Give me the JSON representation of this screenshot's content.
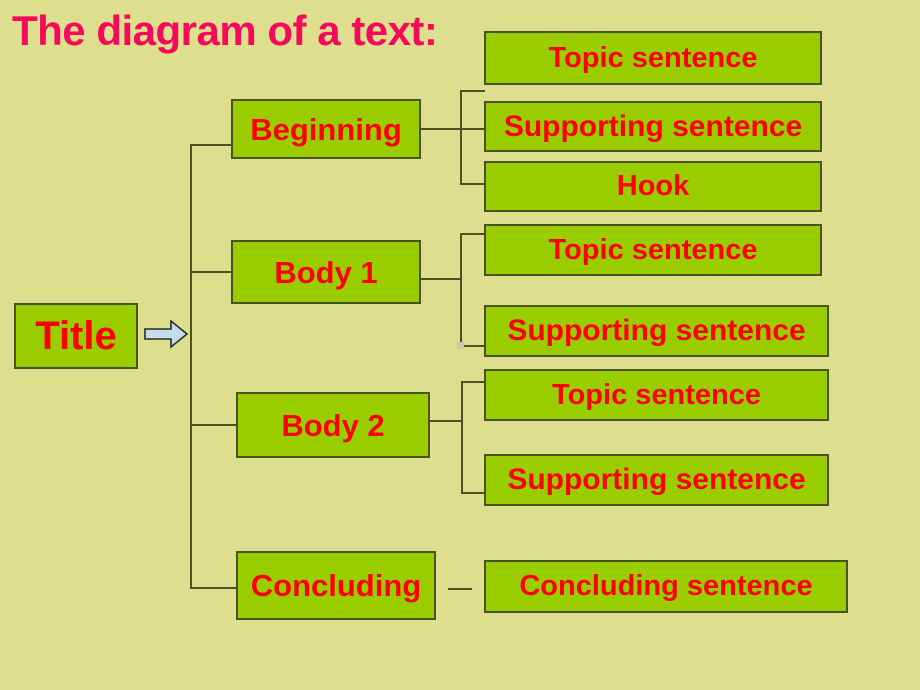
{
  "slide": {
    "title": "The diagram of a text:",
    "background_color": "#dede8f",
    "box_fill_color": "#9acd00",
    "box_border_color": "#4b5320",
    "box_text_color": "#ff0000",
    "title_color": "#f50a5a",
    "arrow_fill_color": "#c5dcea",
    "line_color": "#4b5320"
  },
  "root": {
    "label": "Title"
  },
  "sections": [
    {
      "label": "Beginning",
      "children": [
        {
          "label": "Topic sentence"
        },
        {
          "label": "Supporting sentence"
        },
        {
          "label": "Hook"
        }
      ]
    },
    {
      "label": "Body 1",
      "children": [
        {
          "label": "Topic sentence"
        },
        {
          "label": "Supporting sentence"
        }
      ]
    },
    {
      "label": "Body 2",
      "children": [
        {
          "label": "Topic sentence"
        },
        {
          "label": "Supporting sentence"
        }
      ]
    },
    {
      "label": "Concluding",
      "children": [
        {
          "label": "Concluding sentence"
        }
      ]
    }
  ]
}
